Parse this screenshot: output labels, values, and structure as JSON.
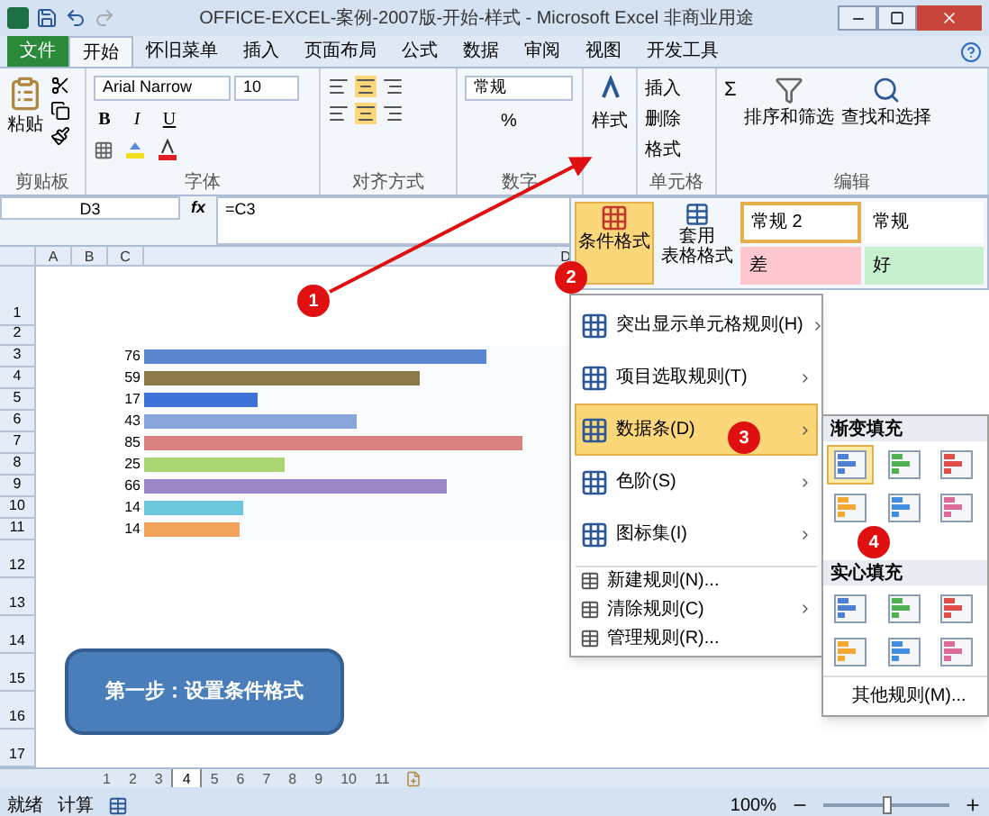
{
  "title_bar": {
    "title": "OFFICE-EXCEL-案例-2007版-开始-样式 - Microsoft Excel 非商业用途"
  },
  "tabs": [
    {
      "label": "文件",
      "kind": "file",
      "selected": false
    },
    {
      "label": "开始",
      "kind": "tab",
      "selected": true
    },
    {
      "label": "怀旧菜单",
      "kind": "tab",
      "selected": false
    },
    {
      "label": "插入",
      "kind": "tab",
      "selected": false
    },
    {
      "label": "页面布局",
      "kind": "tab",
      "selected": false
    },
    {
      "label": "公式",
      "kind": "tab",
      "selected": false
    },
    {
      "label": "数据",
      "kind": "tab",
      "selected": false
    },
    {
      "label": "审阅",
      "kind": "tab",
      "selected": false
    },
    {
      "label": "视图",
      "kind": "tab",
      "selected": false
    },
    {
      "label": "开发工具",
      "kind": "tab",
      "selected": false
    }
  ],
  "ribbon": {
    "paste": "粘贴",
    "clipboard_group": "剪贴板",
    "font_name": "Arial Narrow",
    "font_size": "10",
    "font_buttons": [
      "B",
      "I",
      "U"
    ],
    "font_group": "字体",
    "alignment_group": "对齐方式",
    "number_format": "常规",
    "percent": "%",
    "number_group": "数字",
    "styles": "样式",
    "cells": [
      "插入",
      "删除",
      "格式"
    ],
    "cells_group": "单元格",
    "sum": "Σ",
    "sort_filter": "排序和筛选",
    "find_select": "查找和选择",
    "editing_group": "编辑"
  },
  "formula_bar": {
    "name_box": "D3",
    "fx": "fx",
    "formula": "=C3"
  },
  "styles_panel": {
    "conditional_format": "条件格式",
    "table_format": [
      "套用",
      "表格格式"
    ],
    "cell_styles": [
      {
        "label": "常规 2",
        "color": "#ffffff",
        "selected": true
      },
      {
        "label": "常规",
        "color": "#ffffff",
        "selected": false
      },
      {
        "label": "差",
        "color": "#ffc7ce",
        "selected": false
      },
      {
        "label": "好",
        "color": "#c6efce",
        "selected": false
      }
    ]
  },
  "sheet": {
    "columns": [
      "A",
      "B",
      "C",
      "D"
    ],
    "rows": [
      {
        "number": "1"
      },
      {
        "number": "2"
      },
      {
        "number": "3",
        "value": "76",
        "level": 0.76,
        "color": "#5b87d0"
      },
      {
        "number": "4",
        "value": "59",
        "level": 0.61,
        "color": "#8c7a4a"
      },
      {
        "number": "5",
        "value": "17",
        "level": 0.25,
        "color": "#3d72d6"
      },
      {
        "number": "6",
        "value": "43",
        "level": 0.47,
        "color": "#8aa6dc"
      },
      {
        "number": "7",
        "value": "85",
        "level": 0.84,
        "color": "#da8282"
      },
      {
        "number": "8",
        "value": "25",
        "level": 0.31,
        "color": "#a9d672"
      },
      {
        "number": "9",
        "value": "66",
        "level": 0.67,
        "color": "#9d87c6"
      },
      {
        "number": "10",
        "value": "14",
        "level": 0.22,
        "color": "#6cc6dc"
      },
      {
        "number": "11",
        "value": "14",
        "level": 0.21,
        "color": "#f2a45c"
      },
      {
        "number": "12"
      },
      {
        "number": "13"
      },
      {
        "number": "14"
      },
      {
        "number": "15"
      },
      {
        "number": "16"
      },
      {
        "number": "17"
      }
    ]
  },
  "menu": [
    {
      "label": "突出显示单元格规则(H)",
      "kind": "large",
      "submenu": true,
      "selected": false
    },
    {
      "label": "项目选取规则(T)",
      "kind": "large",
      "submenu": true,
      "selected": false
    },
    {
      "label": "数据条(D)",
      "kind": "large",
      "submenu": true,
      "selected": true
    },
    {
      "label": "色阶(S)",
      "kind": "large",
      "submenu": true,
      "selected": false
    },
    {
      "label": "图标集(I)",
      "kind": "large",
      "submenu": true,
      "selected": false
    },
    {
      "label": "新建规则(N)...",
      "kind": "small",
      "submenu": false,
      "selected": false
    },
    {
      "label": "清除规则(C)",
      "kind": "small",
      "submenu": true,
      "selected": false
    },
    {
      "label": "管理规则(R)...",
      "kind": "small",
      "submenu": false,
      "selected": false
    }
  ],
  "submenu": {
    "sections": [
      {
        "title": "渐变填充",
        "items": [
          {
            "color": "#4f7fd0",
            "selected": true
          },
          {
            "color": "#4caf50",
            "selected": false
          },
          {
            "color": "#e0504a",
            "selected": false
          },
          {
            "color": "#f0a830",
            "selected": false
          },
          {
            "color": "#3f8ee0",
            "selected": false
          },
          {
            "color": "#e06a9a",
            "selected": false
          }
        ]
      },
      {
        "title": "实心填充",
        "items": [
          {
            "color": "#4f7fd0",
            "selected": false
          },
          {
            "color": "#4caf50",
            "selected": false
          },
          {
            "color": "#e0504a",
            "selected": false
          },
          {
            "color": "#f0a830",
            "selected": false
          },
          {
            "color": "#3f8ee0",
            "selected": false
          },
          {
            "color": "#e06a9a",
            "selected": false
          }
        ]
      }
    ],
    "more": "其他规则(M)..."
  },
  "callouts": [
    "1",
    "2",
    "3",
    "4"
  ],
  "note_shape": "第一步：设置条件格式",
  "sheet_tabs": [
    {
      "label": "1",
      "selected": false
    },
    {
      "label": "2",
      "selected": false
    },
    {
      "label": "3",
      "selected": false
    },
    {
      "label": "4",
      "selected": true
    },
    {
      "label": "5",
      "selected": false
    },
    {
      "label": "6",
      "selected": false
    },
    {
      "label": "7",
      "selected": false
    },
    {
      "label": "8",
      "selected": false
    },
    {
      "label": "9",
      "selected": false
    },
    {
      "label": "10",
      "selected": false
    },
    {
      "label": "11",
      "selected": false
    }
  ],
  "status_bar": {
    "ready": "就绪",
    "calculate": "计算",
    "zoom": "100%",
    "zoom_level": {
      "level": 0.5
    }
  }
}
